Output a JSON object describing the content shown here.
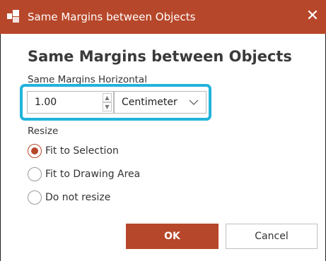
{
  "titlebar": {
    "title": "Same Margins between Objects",
    "close_symbol": "✕",
    "icon": "app-icon",
    "color": "#b7472a"
  },
  "dialog": {
    "heading": "Same Margins between Objects",
    "section_label": "Same Margins Horizontal",
    "margin_value": "1.00",
    "unit_selected": "Centimeter",
    "resize_label": "Resize",
    "resize_options": [
      {
        "label": "Fit to Selection",
        "selected": true
      },
      {
        "label": "Fit to Drawing Area",
        "selected": false
      },
      {
        "label": "Do not resize",
        "selected": false
      }
    ],
    "highlight_color": "#22b3dc"
  },
  "buttons": {
    "ok": "OK",
    "cancel": "Cancel"
  }
}
